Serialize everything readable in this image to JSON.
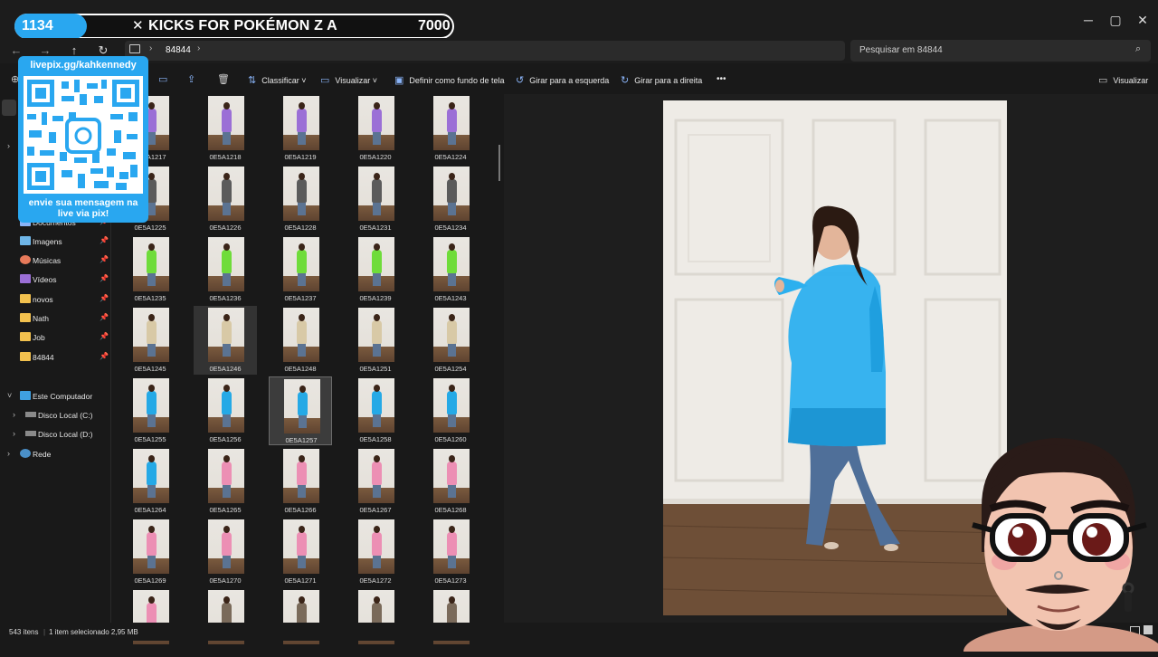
{
  "stream": {
    "counter": "1134",
    "title": "KICKS FOR POKÉMON Z A",
    "goal": "7000"
  },
  "window": {
    "minimize": "─",
    "maximize": "▢",
    "close": "✕"
  },
  "address": {
    "path": "84844",
    "search_placeholder": "Pesquisar em 84844"
  },
  "toolbar": {
    "sort": "Classificar",
    "view": "Visualizar",
    "set_wallpaper": "Definir como fundo de tela",
    "rotate_left": "Girar para a esquerda",
    "rotate_right": "Girar para a direita",
    "more": "•••",
    "preview": "Visualizar"
  },
  "sidebar": {
    "quick": [
      {
        "label": "Documentos",
        "icon": "documents-icon"
      },
      {
        "label": "Imagens",
        "icon": "pictures-icon"
      },
      {
        "label": "Músicas",
        "icon": "music-icon"
      },
      {
        "label": "Vídeos",
        "icon": "videos-icon"
      },
      {
        "label": "novos",
        "icon": "folder-icon"
      },
      {
        "label": "Nath",
        "icon": "folder-icon"
      },
      {
        "label": "Job",
        "icon": "folder-icon"
      },
      {
        "label": "84844",
        "icon": "folder-icon"
      }
    ],
    "pc": "Este Computador",
    "drives": [
      "Disco Local (C:)",
      "Disco Local (D:)"
    ],
    "network": "Rede"
  },
  "files": [
    {
      "name": "0E5A1217",
      "color": "#9b6fd6"
    },
    {
      "name": "0E5A1218",
      "color": "#9b6fd6"
    },
    {
      "name": "0E5A1219",
      "color": "#9b6fd6"
    },
    {
      "name": "0E5A1220",
      "color": "#9b6fd6"
    },
    {
      "name": "0E5A1224",
      "color": "#9b6fd6"
    },
    {
      "name": "0E5A1225",
      "color": "#5b5b5b"
    },
    {
      "name": "0E5A1226",
      "color": "#5b5b5b"
    },
    {
      "name": "0E5A1228",
      "color": "#5b5b5b"
    },
    {
      "name": "0E5A1231",
      "color": "#5b5b5b"
    },
    {
      "name": "0E5A1234",
      "color": "#5b5b5b"
    },
    {
      "name": "0E5A1235",
      "color": "#6fdc3a"
    },
    {
      "name": "0E5A1236",
      "color": "#6fdc3a"
    },
    {
      "name": "0E5A1237",
      "color": "#6fdc3a"
    },
    {
      "name": "0E5A1239",
      "color": "#6fdc3a"
    },
    {
      "name": "0E5A1243",
      "color": "#6fdc3a"
    },
    {
      "name": "0E5A1245",
      "color": "#d8c9a6"
    },
    {
      "name": "0E5A1246",
      "color": "#d8c9a6"
    },
    {
      "name": "0E5A1248",
      "color": "#d8c9a6"
    },
    {
      "name": "0E5A1251",
      "color": "#d8c9a6"
    },
    {
      "name": "0E5A1254",
      "color": "#d8c9a6"
    },
    {
      "name": "0E5A1255",
      "color": "#25a9e6"
    },
    {
      "name": "0E5A1256",
      "color": "#25a9e6"
    },
    {
      "name": "0E5A1257",
      "color": "#25a9e6"
    },
    {
      "name": "0E5A1258",
      "color": "#25a9e6"
    },
    {
      "name": "0E5A1260",
      "color": "#25a9e6"
    },
    {
      "name": "0E5A1264",
      "color": "#25a9e6"
    },
    {
      "name": "0E5A1265",
      "color": "#ec8fb4"
    },
    {
      "name": "0E5A1266",
      "color": "#ec8fb4"
    },
    {
      "name": "0E5A1267",
      "color": "#ec8fb4"
    },
    {
      "name": "0E5A1268",
      "color": "#ec8fb4"
    },
    {
      "name": "0E5A1269",
      "color": "#ec8fb4"
    },
    {
      "name": "0E5A1270",
      "color": "#ec8fb4"
    },
    {
      "name": "0E5A1271",
      "color": "#ec8fb4"
    },
    {
      "name": "0E5A1272",
      "color": "#ec8fb4"
    },
    {
      "name": "0E5A1273",
      "color": "#ec8fb4"
    },
    {
      "name": "",
      "color": "#ec8fb4"
    },
    {
      "name": "",
      "color": "#7a6a5a"
    },
    {
      "name": "",
      "color": "#7a6a5a"
    },
    {
      "name": "",
      "color": "#7a6a5a"
    },
    {
      "name": "",
      "color": "#7a6a5a"
    }
  ],
  "selected_file": "0E5A1257",
  "status": {
    "count": "543 itens",
    "selection": "1 item selecionado 2,95 MB"
  },
  "overlay": {
    "url": "livepix.gg/kahkennedy",
    "message": "envie sua mensagem na live via pix!"
  },
  "colors": {
    "accent": "#29a7f0",
    "coat": "#2cb0ef",
    "jeans": "#4f6f99"
  }
}
